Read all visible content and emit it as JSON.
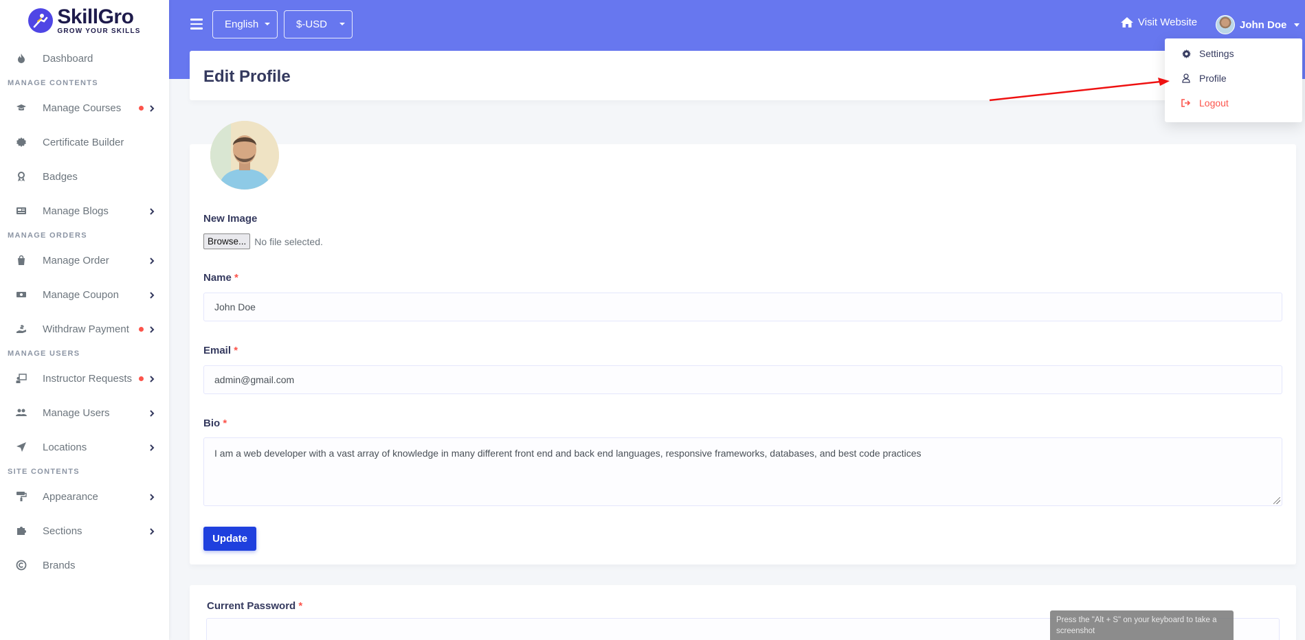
{
  "brand": {
    "name": "SkillGro",
    "tagline": "GROW YOUR SKILLS"
  },
  "sidebar": {
    "items": [
      {
        "type": "item",
        "label": "Dashboard",
        "icon": "fire-icon"
      },
      {
        "type": "header",
        "label": "MANAGE CONTENTS"
      },
      {
        "type": "item",
        "label": "Manage Courses",
        "icon": "graduation-cap-icon",
        "dot": true,
        "chevron": true
      },
      {
        "type": "item",
        "label": "Certificate Builder",
        "icon": "certificate-icon"
      },
      {
        "type": "item",
        "label": "Badges",
        "icon": "award-icon"
      },
      {
        "type": "item",
        "label": "Manage Blogs",
        "icon": "newspaper-icon",
        "chevron": true
      },
      {
        "type": "header",
        "label": "MANAGE ORDERS"
      },
      {
        "type": "item",
        "label": "Manage Order",
        "icon": "shopping-bag-icon",
        "chevron": true
      },
      {
        "type": "item",
        "label": "Manage Coupon",
        "icon": "money-bill-icon",
        "chevron": true
      },
      {
        "type": "item",
        "label": "Withdraw Payment",
        "icon": "hand-holding-usd-icon",
        "dot": true,
        "chevron": true
      },
      {
        "type": "header",
        "label": "MANAGE USERS"
      },
      {
        "type": "item",
        "label": "Instructor Requests",
        "icon": "chalkboard-teacher-icon",
        "dot": true,
        "chevron": true
      },
      {
        "type": "item",
        "label": "Manage Users",
        "icon": "users-icon",
        "chevron": true
      },
      {
        "type": "item",
        "label": "Locations",
        "icon": "location-arrow-icon",
        "chevron": true
      },
      {
        "type": "header",
        "label": "SITE CONTENTS"
      },
      {
        "type": "item",
        "label": "Appearance",
        "icon": "paint-roller-icon",
        "chevron": true
      },
      {
        "type": "item",
        "label": "Sections",
        "icon": "puzzle-piece-icon",
        "chevron": true
      },
      {
        "type": "item",
        "label": "Brands",
        "icon": "copyright-icon"
      }
    ]
  },
  "topbar": {
    "language": "English",
    "currency": "$-USD",
    "visit_website": "Visit Website",
    "user_name": "John Doe"
  },
  "dropdown": {
    "settings": "Settings",
    "profile": "Profile",
    "logout": "Logout"
  },
  "page": {
    "title": "Edit Profile"
  },
  "form": {
    "new_image_label": "New Image",
    "browse_label": "Browse...",
    "no_file": "No file selected.",
    "name_label": "Name",
    "name_value": "John Doe",
    "email_label": "Email",
    "email_value": "admin@gmail.com",
    "bio_label": "Bio",
    "bio_value": "I am a web developer with a vast array of knowledge in many different front end and back end languages, responsive frameworks, databases, and best code practices",
    "required_mark": "*",
    "update_button": "Update"
  },
  "password_form": {
    "current_password_label": "Current Password"
  },
  "toast": {
    "text": "Press the \"Alt + S\" on your keyboard to take a screenshot"
  },
  "colors": {
    "accent": "#6777ef",
    "primary_button": "#1f40de",
    "danger": "#fc544b",
    "arrow": "#ee1111"
  }
}
